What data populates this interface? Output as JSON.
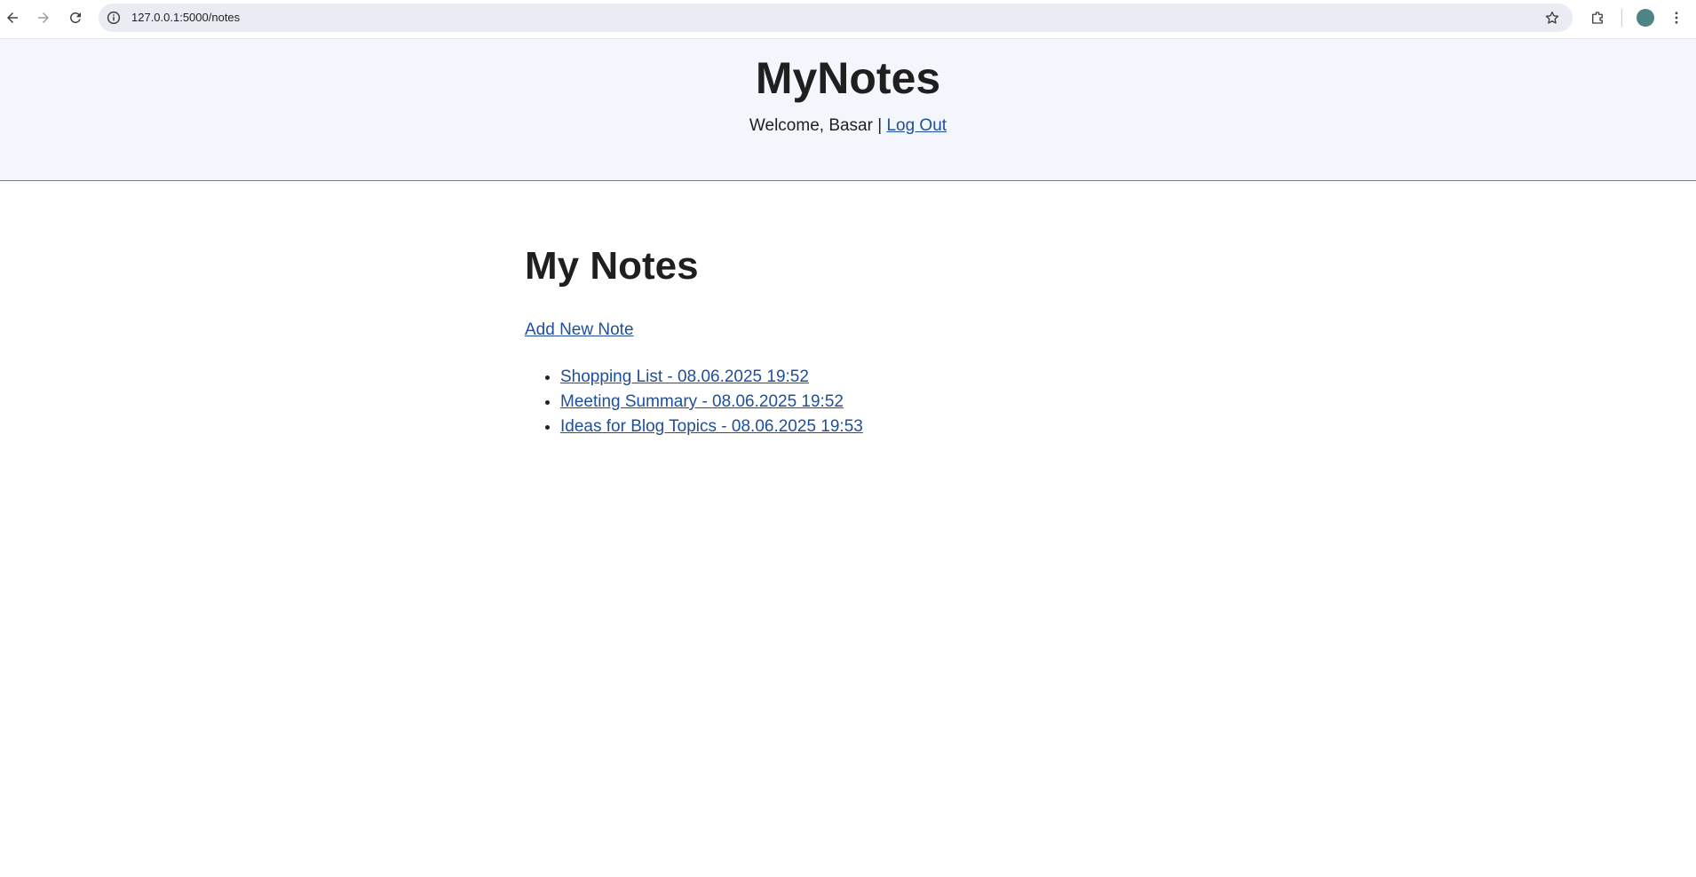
{
  "browser": {
    "url": "127.0.0.1:5000/notes"
  },
  "header": {
    "site_title": "MyNotes",
    "welcome_text": "Welcome, Basar | ",
    "logout_label": "Log Out"
  },
  "main": {
    "page_title": "My Notes",
    "add_note_label": "Add New Note",
    "notes": [
      "Shopping List - 08.06.2025 19:52",
      "Meeting Summary - 08.06.2025 19:52",
      "Ideas for Blog Topics - 08.06.2025 19:53"
    ]
  },
  "colors": {
    "header_bg": "#f3f7fd",
    "link": "#1f4e9c",
    "avatar": "#4f8386"
  },
  "icons": [
    "back-arrow-icon",
    "forward-arrow-icon",
    "reload-icon",
    "site-info-icon",
    "bookmark-star-icon",
    "extensions-icon",
    "profile-avatar",
    "kebab-menu-icon"
  ]
}
